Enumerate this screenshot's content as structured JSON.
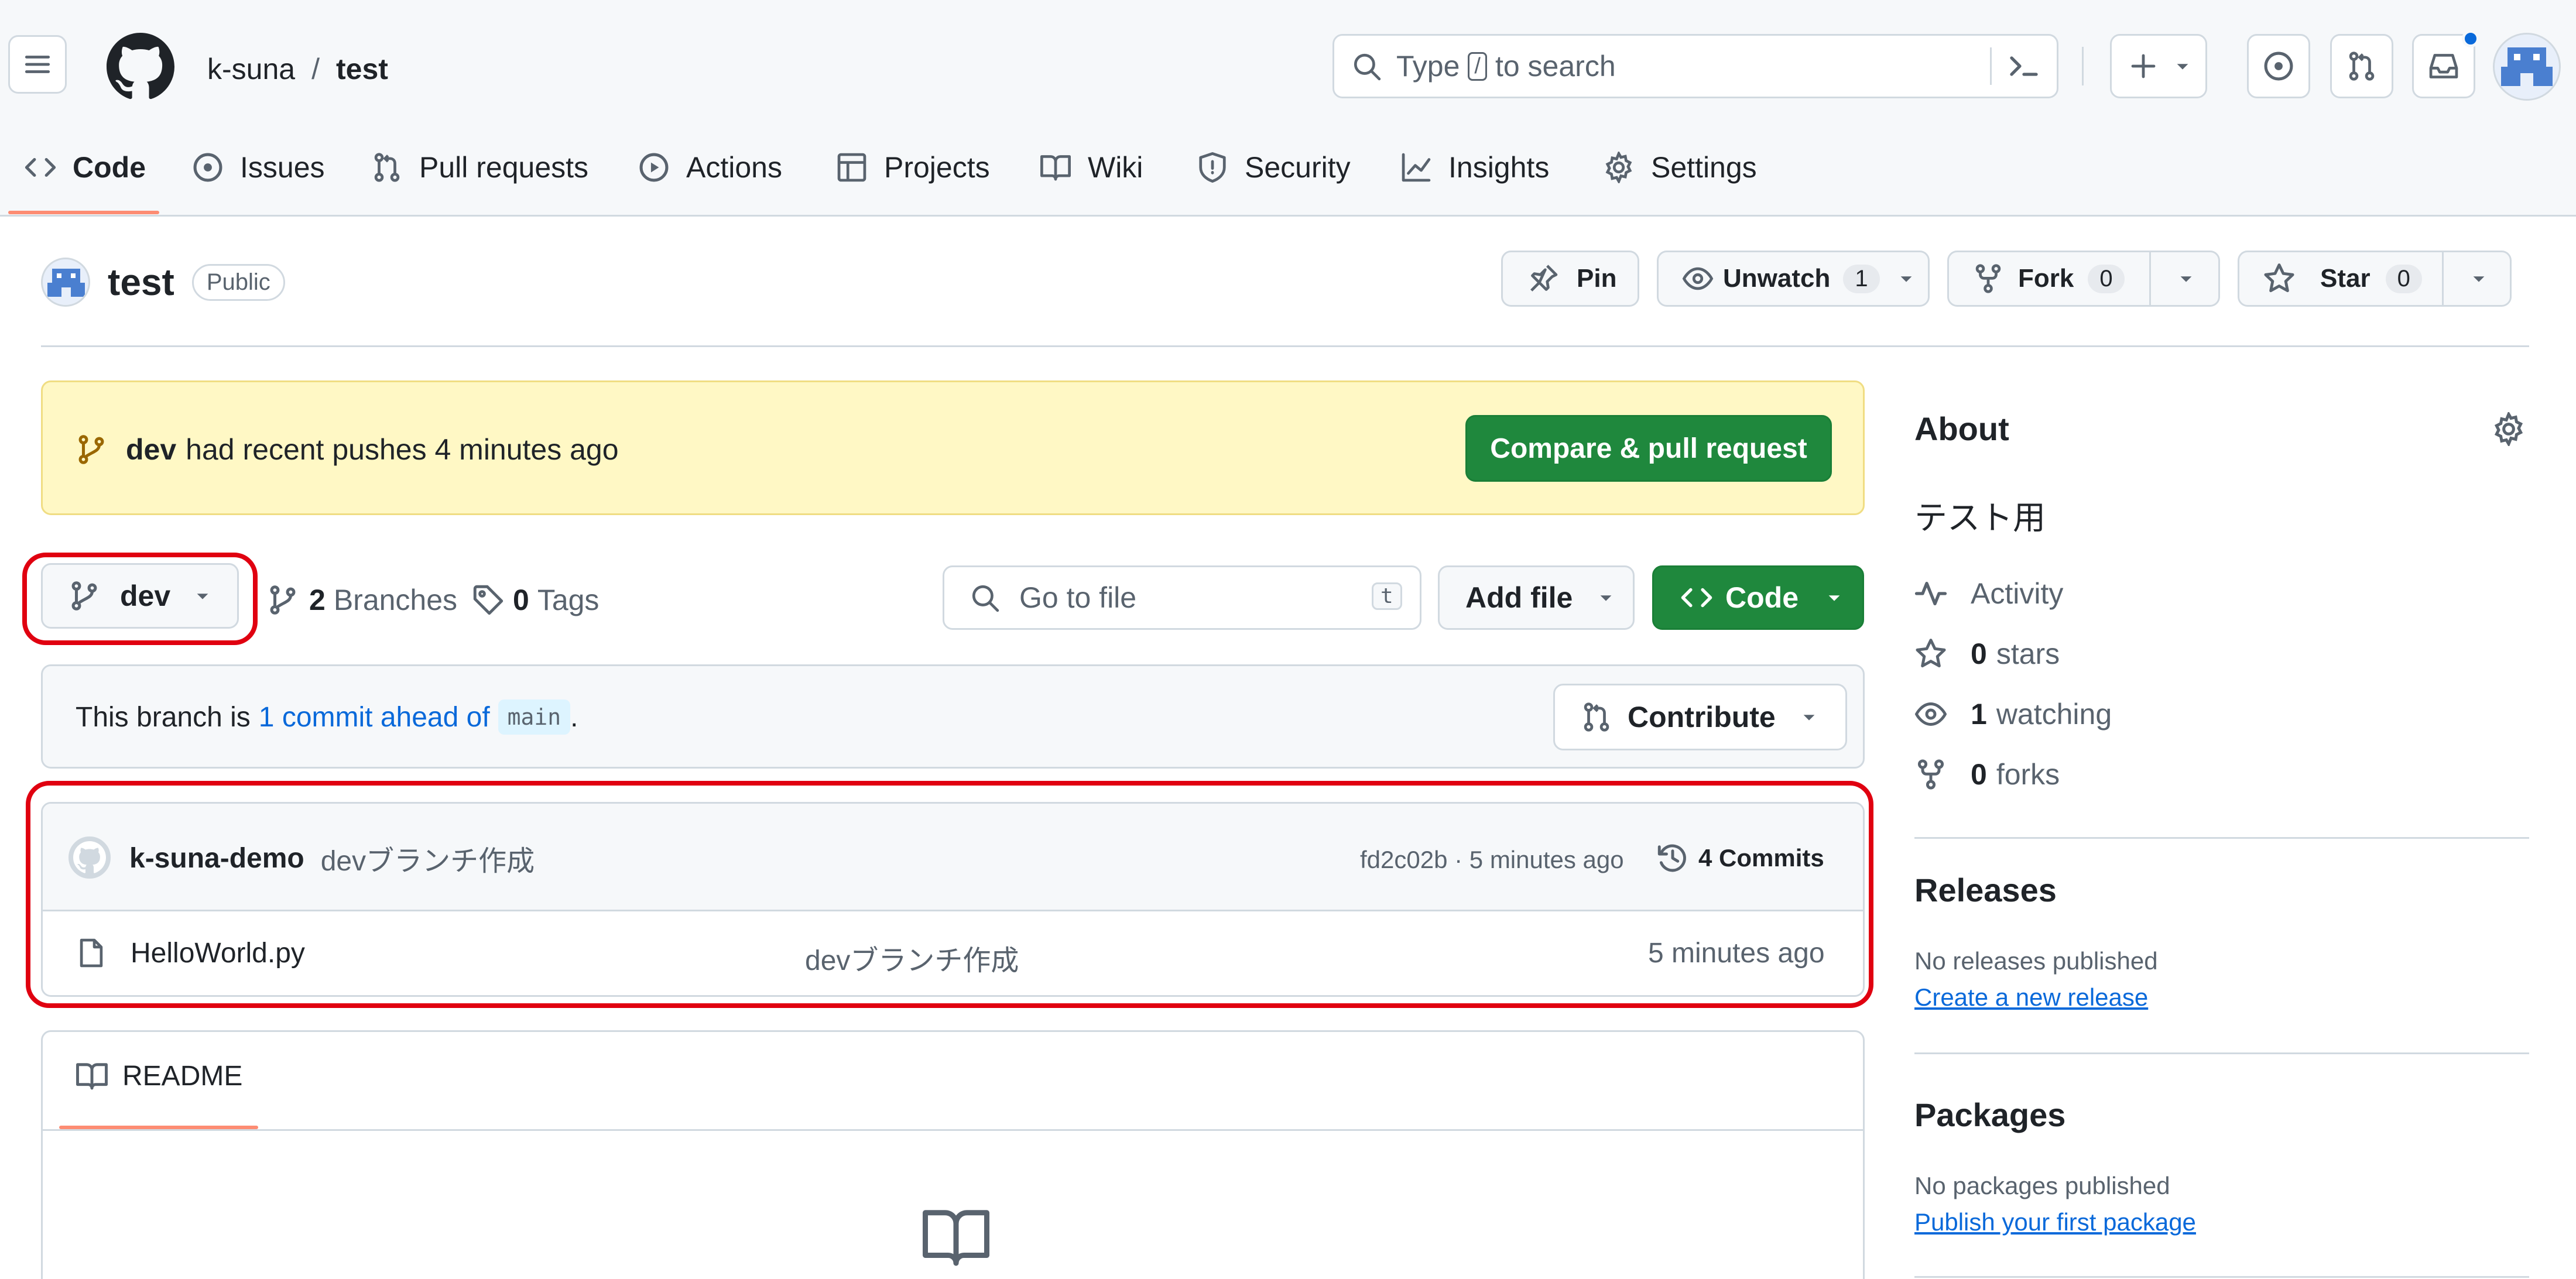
{
  "header": {
    "owner": "k-suna",
    "separator": "/",
    "repo": "test",
    "search_placeholder_before": "Type",
    "search_key": "/",
    "search_placeholder_after": "to search"
  },
  "nav_tabs": [
    {
      "label": "Code"
    },
    {
      "label": "Issues"
    },
    {
      "label": "Pull requests"
    },
    {
      "label": "Actions"
    },
    {
      "label": "Projects"
    },
    {
      "label": "Wiki"
    },
    {
      "label": "Security"
    },
    {
      "label": "Insights"
    },
    {
      "label": "Settings"
    }
  ],
  "repo": {
    "name": "test",
    "visibility": "Public",
    "pin_label": "Pin",
    "watch_label": "Unwatch",
    "watch_count": "1",
    "fork_label": "Fork",
    "fork_count": "0",
    "star_label": "Star",
    "star_count": "0"
  },
  "push_banner": {
    "branch": "dev",
    "text": "had recent pushes 4 minutes ago",
    "button": "Compare & pull request"
  },
  "branch_bar": {
    "current_branch": "dev",
    "branches_count": "2",
    "branches_label": "Branches",
    "tags_count": "0",
    "tags_label": "Tags",
    "goto_placeholder": "Go to file",
    "goto_key": "t",
    "add_file": "Add file",
    "code_button": "Code"
  },
  "ahead": {
    "prefix": "This branch is",
    "link": "1 commit ahead of",
    "base": "main",
    "suffix": ".",
    "contribute": "Contribute"
  },
  "commit": {
    "author": "k-suna-demo",
    "message": "devブランチ作成",
    "meta": "fd2c02b · 5 minutes ago",
    "commits_label": "4 Commits"
  },
  "files": [
    {
      "name": "HelloWorld.py",
      "message": "devブランチ作成",
      "time": "5 minutes ago"
    }
  ],
  "readme": {
    "tab": "README"
  },
  "about": {
    "title": "About",
    "description": "テスト用",
    "activity": "Activity",
    "stars_count": "0",
    "stars_label": "stars",
    "watching_count": "1",
    "watching_label": "watching",
    "forks_count": "0",
    "forks_label": "forks"
  },
  "releases": {
    "title": "Releases",
    "empty": "No releases published",
    "link": "Create a new release"
  },
  "packages": {
    "title": "Packages",
    "empty": "No packages published",
    "link": "Publish your first package"
  },
  "colors": {
    "accent_green": "#1f883d",
    "link_blue": "#0969da",
    "banner_yellow": "#fff8c5",
    "active_tab_underline": "#fd8c73",
    "annotation_red": "#e00010"
  }
}
